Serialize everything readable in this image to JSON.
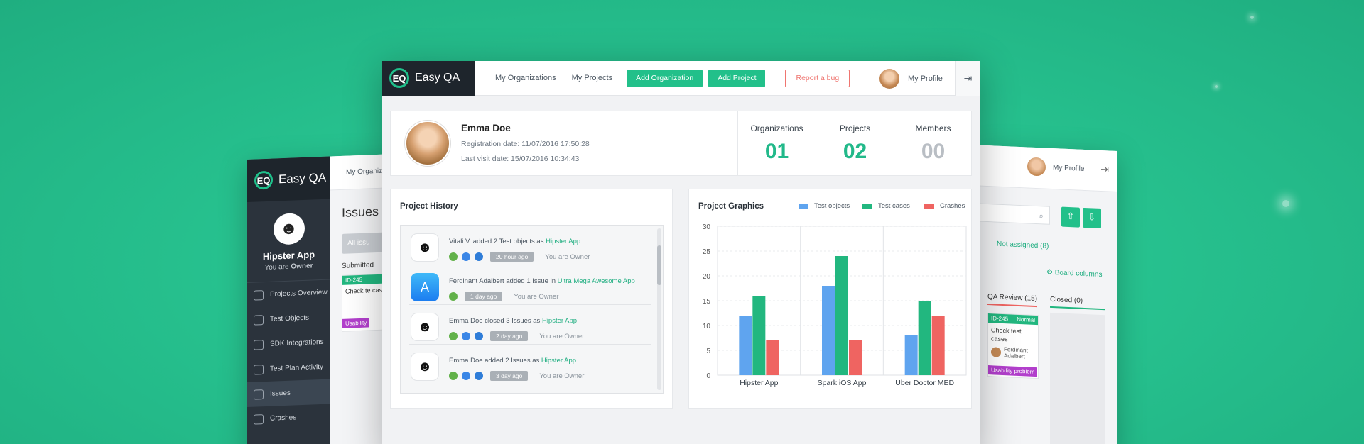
{
  "brand": {
    "name": "Easy QA",
    "logo_letters": "EQ"
  },
  "colors": {
    "accent": "#22c08a",
    "danger": "#ef7570",
    "dark": "#1e252c",
    "test_objects": "#5fa4ef",
    "test_cases": "#22b77f",
    "crashes": "#ef6461"
  },
  "left_window": {
    "brand": "Easy QA",
    "project_name": "Hipster App",
    "project_role_prefix": "You are",
    "project_role": "Owner",
    "top_nav": "My Organiz",
    "nav": [
      {
        "label": "Projects Overview",
        "icon": "speedometer-icon"
      },
      {
        "label": "Test Objects",
        "icon": "document-icon"
      },
      {
        "label": "SDK Integrations",
        "icon": "layers-icon"
      },
      {
        "label": "Test Plan Activity",
        "icon": "chart-icon"
      },
      {
        "label": "Issues",
        "icon": "bug-icon"
      },
      {
        "label": "Crashes",
        "icon": "warning-icon"
      }
    ],
    "page_title": "Issues",
    "all_button": "All issu",
    "column": "Submitted",
    "card_id": "ID-245",
    "card_title": "Check te cases",
    "card_badge": "Usability"
  },
  "right_window": {
    "profile": "My Profile",
    "not_assigned": "Not assigned (8)",
    "board_columns": "Board columns",
    "col_review": "QA Review (15)",
    "col_closed": "Closed (0)",
    "card_id": "ID-245",
    "card_priority": "Normal",
    "card_title": "Check test cases",
    "card_assignee": "Ferdinant Adalbert",
    "card_badge": "Usability problem"
  },
  "topbar": {
    "my_organizations": "My Organizations",
    "my_projects": "My Projects",
    "add_organization": "Add Organization",
    "add_project": "Add Project",
    "report_bug": "Report a bug",
    "my_profile": "My Profile"
  },
  "profile": {
    "name": "Emma Doe",
    "registration": "Registration date: 11/07/2016 17:50:28",
    "last_visit": "Last visit date: 15/07/2016 10:34:43",
    "stats": [
      {
        "label": "Organizations",
        "value": "01"
      },
      {
        "label": "Projects",
        "value": "02"
      },
      {
        "label": "Members",
        "value": "00"
      }
    ]
  },
  "history": {
    "title": "Project History",
    "items": [
      {
        "icon": "hipster-logo-icon",
        "text": "Vitali V. added 2 Test objects as ",
        "link": "Hipster App",
        "time": "20 hour ago",
        "role": "You are Owner",
        "dots": 3
      },
      {
        "icon": "appstore-icon",
        "text": "Ferdinant Adalbert added 1 Issue in ",
        "link": "Ultra Mega Awesome App",
        "time": "1 day ago",
        "role": "You are Owner",
        "dots": 1
      },
      {
        "icon": "hipster-logo-icon",
        "text": "Emma Doe closed 3 Issues as ",
        "link": "Hipster App",
        "time": "2 day ago",
        "role": "You are Owner",
        "dots": 3
      },
      {
        "icon": "hipster-logo-icon",
        "text": "Emma Doe added 2 Issues as ",
        "link": "Hipster App",
        "time": "3 day ago",
        "role": "You are Owner",
        "dots": 3
      }
    ]
  },
  "graphics": {
    "title": "Project Graphics"
  },
  "chart_data": {
    "type": "bar",
    "title": "",
    "categories": [
      "Hipster App",
      "Spark iOS App",
      "Uber Doctor MED"
    ],
    "series": [
      {
        "name": "Test objects",
        "values": [
          12,
          18,
          8
        ]
      },
      {
        "name": "Test cases",
        "values": [
          16,
          24,
          15
        ]
      },
      {
        "name": "Crashes",
        "values": [
          7,
          7,
          12
        ]
      }
    ],
    "ylim": [
      0,
      30
    ],
    "yticks": [
      0,
      5,
      10,
      15,
      20,
      25,
      30
    ],
    "grid": true,
    "legend": "top-right"
  }
}
